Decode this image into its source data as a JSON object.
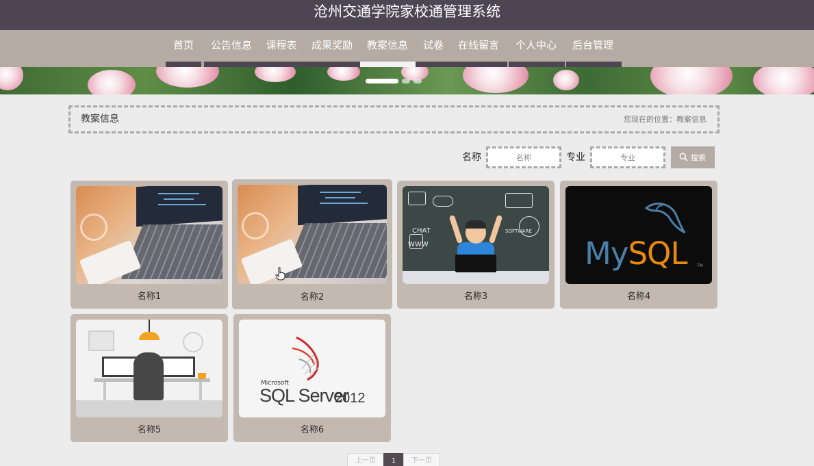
{
  "header": {
    "title": "沧州交通学院家校通管理系统"
  },
  "nav": {
    "items": [
      {
        "label": "首页"
      },
      {
        "label": "公告信息"
      },
      {
        "label": "课程表"
      },
      {
        "label": "成果奖励"
      },
      {
        "label": "教案信息",
        "active": true
      },
      {
        "label": "试卷"
      },
      {
        "label": "在线留言"
      },
      {
        "label": "个人中心"
      },
      {
        "label": "后台管理"
      }
    ]
  },
  "banner": {
    "slide_count": 3,
    "active_slide": 1
  },
  "breadcrumb": {
    "section_title": "教案信息",
    "location_text": "您现在的位置：教案信息"
  },
  "search": {
    "name_label": "名称",
    "name_placeholder": "名称",
    "major_label": "专业",
    "major_placeholder": "专业",
    "button_label": "搜索"
  },
  "cards": [
    {
      "name": "名称1",
      "image": "laptop-photo"
    },
    {
      "name": "名称2",
      "image": "laptop-photo"
    },
    {
      "name": "名称3",
      "image": "kid-chalkboard-photo"
    },
    {
      "name": "名称4",
      "image": "mysql-logo"
    },
    {
      "name": "名称5",
      "image": "office-illustration"
    },
    {
      "name": "名称6",
      "image": "sql-server-2012-logo"
    }
  ],
  "mysql_logo": {
    "my": "My",
    "sql": "SQL",
    "tm": "TM"
  },
  "sqlserver_logo": {
    "vendor": "Microsoft",
    "product": "SQL Server",
    "version": "2012"
  },
  "chalkboard_words": [
    "CHAT",
    "WWW",
    "SOFTWARE"
  ],
  "pagination": {
    "prev_label": "上一页",
    "current_page": "1",
    "next_label": "下一页"
  },
  "colors": {
    "header_bg": "#4d4554",
    "nav_bg": "#b5aba3",
    "card_bg": "#c3b9b0",
    "search_button_bg": "#b3aba4",
    "page_active_bg": "#514a50"
  }
}
